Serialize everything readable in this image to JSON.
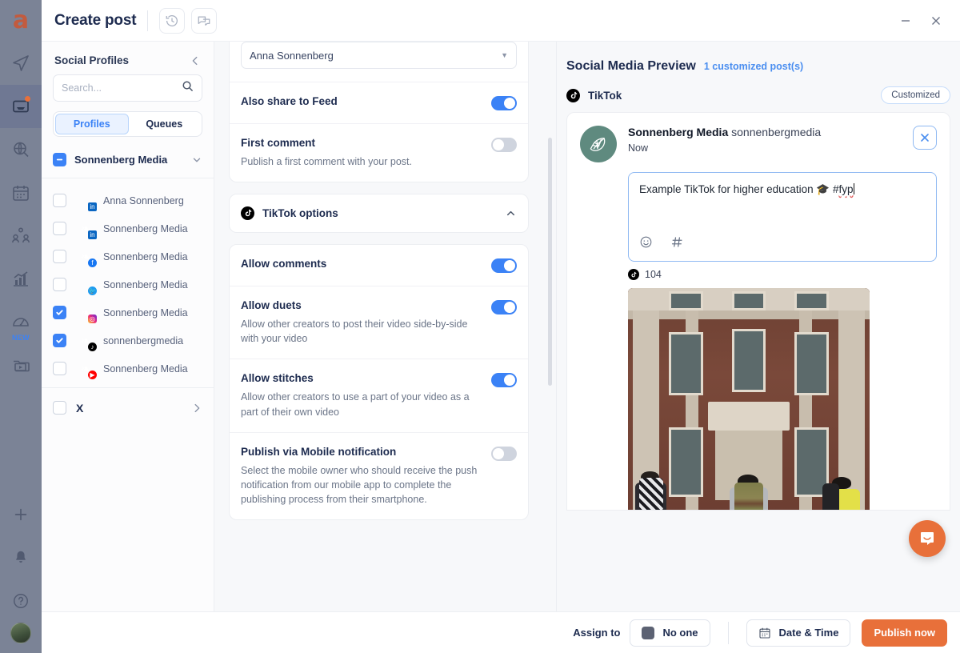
{
  "app_rail": {
    "logo": "a",
    "items": [
      {
        "name": "publisher-icon",
        "label": "Publisher",
        "active": false,
        "dot": false,
        "badge": ""
      },
      {
        "name": "inbox-icon",
        "label": "Inbox",
        "active": true,
        "dot": true,
        "badge": ""
      },
      {
        "name": "monitoring-icon",
        "label": "Monitoring",
        "active": false,
        "dot": false,
        "badge": ""
      },
      {
        "name": "calendar-icon",
        "label": "Calendar",
        "active": false,
        "dot": false,
        "badge": ""
      },
      {
        "name": "audience-icon",
        "label": "Audience",
        "active": false,
        "dot": false,
        "badge": ""
      },
      {
        "name": "analytics-icon",
        "label": "Analytics",
        "active": false,
        "dot": false,
        "badge": ""
      },
      {
        "name": "benchmark-icon",
        "label": "Benchmark",
        "active": false,
        "dot": false,
        "badge": "NEW"
      },
      {
        "name": "media-library-icon",
        "label": "Media library",
        "active": false,
        "dot": false,
        "badge": ""
      }
    ],
    "bottom_items": [
      {
        "name": "add-icon",
        "label": "Create"
      },
      {
        "name": "bell-icon",
        "label": "Notifications"
      },
      {
        "name": "help-icon",
        "label": "Help"
      }
    ]
  },
  "titlebar": {
    "title": "Create post",
    "history_button": "history-icon",
    "comments_button": "comments-icon",
    "minimize": "minimize-icon",
    "close": "close-icon"
  },
  "sidebar": {
    "heading": "Social Profiles",
    "collapse_icon": "chevron-left-icon",
    "search": {
      "placeholder": "Search...",
      "value": "",
      "icon": "search-icon"
    },
    "tabs": [
      {
        "label": "Profiles",
        "selected": true
      },
      {
        "label": "Queues",
        "selected": false
      }
    ],
    "group": {
      "label": "Sonnenberg Media",
      "state": "indeterminate",
      "expanded": true
    },
    "profiles": [
      {
        "name": "Anna Sonnenberg",
        "network": "linkedin",
        "checked": false,
        "avatar": "person"
      },
      {
        "name": "Sonnenberg Media",
        "network": "linkedin",
        "checked": false,
        "avatar": "leaf"
      },
      {
        "name": "Sonnenberg Media",
        "network": "facebook",
        "checked": false,
        "avatar": "leaf"
      },
      {
        "name": "Sonnenberg Media",
        "network": "twitter",
        "checked": false,
        "avatar": "person"
      },
      {
        "name": "Sonnenberg Media",
        "network": "instagram",
        "checked": true,
        "avatar": "leaf"
      },
      {
        "name": "sonnenbergmedia",
        "network": "tiktok",
        "checked": true,
        "avatar": "leaf"
      },
      {
        "name": "Sonnenberg Media",
        "network": "youtube",
        "checked": false,
        "avatar": "leaf"
      }
    ],
    "networks": [
      {
        "label": "X",
        "checked": false,
        "expand_icon": "chevron-right-icon"
      }
    ]
  },
  "compose": {
    "owner_select": {
      "value": "Anna Sonnenberg",
      "caret": "chevron-down-icon"
    },
    "options": [
      {
        "title": "Also share to Feed",
        "description": "",
        "toggle": true
      },
      {
        "title": "First comment",
        "description": "Publish a first comment with your post.",
        "toggle": false
      }
    ],
    "section": {
      "title": "TikTok options",
      "icon": "tiktok-icon",
      "collapse_icon": "chevron-up-icon",
      "expanded": true,
      "options": [
        {
          "title": "Allow comments",
          "description": "",
          "toggle": true
        },
        {
          "title": "Allow duets",
          "description": "Allow other creators to post their video side-by-side with your video",
          "toggle": true
        },
        {
          "title": "Allow stitches",
          "description": "Allow other creators to use a part of your video as a part of their own video",
          "toggle": true
        },
        {
          "title": "Publish via Mobile notification",
          "description": "Select the mobile owner who should receive the push notification from our mobile app to complete the publishing process from their smartphone.",
          "toggle": false
        }
      ]
    }
  },
  "preview": {
    "title": "Social Media Preview",
    "customized_count": "1 customized post(s)",
    "network": {
      "name": "TikTok",
      "icon": "tiktok-icon",
      "badge": "Customized"
    },
    "post": {
      "display_name": "Sonnenberg Media",
      "handle": "sonnenbergmedia",
      "time": "Now",
      "close_icon": "close-icon",
      "text_before": "Example TikTok for higher education ",
      "emoji": "🎓",
      "text_after": " #",
      "misspelled": "fyp",
      "char_count": "104",
      "char_icon": "tiktok-icon",
      "emoji_button": "emoji-icon",
      "hashtag_button": "hashtag-icon",
      "media_alt": "Three students with backpacks walking up steps toward a brick campus building"
    },
    "help_bubble": "intercom-chat-icon"
  },
  "footer": {
    "assign_label": "Assign to",
    "assignee": "No one",
    "assignee_icon": "avatar-square-icon",
    "date_time_label": "Date & Time",
    "date_time_icon": "calendar-icon",
    "publish_label": "Publish now"
  },
  "colors": {
    "accent_blue": "#3b82f6",
    "accent_orange": "#e8703a",
    "rail_bg": "#7b8396",
    "text_dark": "#1d2b4f"
  }
}
